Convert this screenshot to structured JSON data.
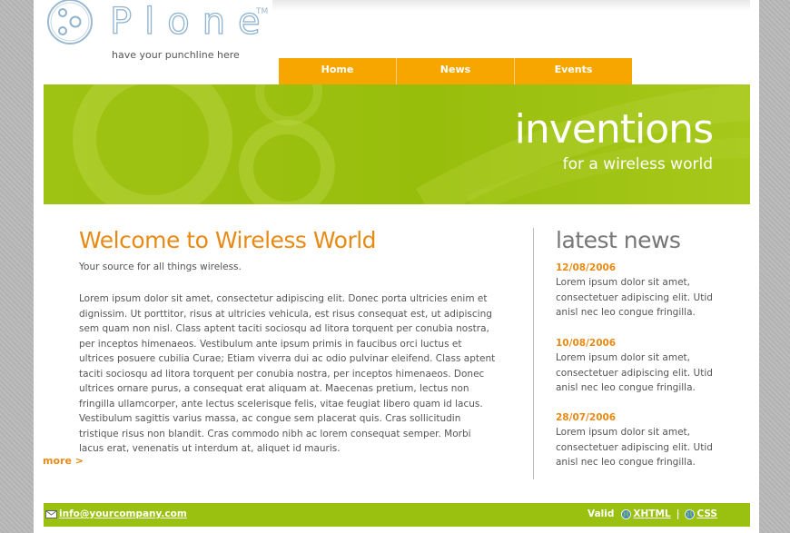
{
  "header": {
    "logo_text": "Plone",
    "logo_tm": "TM",
    "punchline": "have your punchline here"
  },
  "nav": [
    "Home",
    "News",
    "Events"
  ],
  "banner": {
    "title": "inventions",
    "subtitle": "for a wireless world"
  },
  "main": {
    "heading": "Welcome to Wireless World",
    "tagline": "Your source for all things wireless.",
    "body": "Lorem ipsum dolor sit amet, consectetur adipiscing elit. Donec porta ultricies enim et dignissim. Ut porttitor, risus at ultricies vehicula, est risus consequat est, ut adipiscing sem quam non nisl. Class aptent taciti sociosqu ad litora torquent per conubia nostra, per inceptos himenaeos. Vestibulum ante ipsum primis in faucibus orci luctus et ultrices posuere cubilia Curae; Etiam viverra dui ac odio pulvinar eleifend. Class aptent taciti sociosqu ad litora torquent per conubia nostra, per inceptos himenaeos. Donec ultrices ornare purus, a consequat erat aliquam at. Maecenas pretium, lectus non fringilla ullamcorper, ante lectus scelerisque felis, vitae feugiat libero quam id lacus. Vestibulum sagittis varius massa, ac congue sem placerat quis. Cras sollicitudin tristique risus non blandit. Cras commodo nibh ac lorem consequat semper. Morbi lacus erat, venenatis ut interdum at, aliquet id mauris.",
    "more": "more >"
  },
  "news": {
    "heading": "latest news",
    "items": [
      {
        "date": "12/08/2006",
        "text": "Lorem ipsum dolor sit amet, consectetuer adipiscing elit. Utid anisl nec leo congue fringilla."
      },
      {
        "date": "10/08/2006",
        "text": "Lorem ipsum dolor sit amet, consectetuer adipiscing elit. Utid anisl nec leo congue fringilla."
      },
      {
        "date": "28/07/2006",
        "text": "Lorem ipsum dolor sit amet, consectetuer adipiscing elit. Utid anisl nec leo congue fringilla."
      }
    ]
  },
  "footer": {
    "email": "info@yourcompany.com",
    "valid_label": "Valid",
    "xhtml": "XHTML",
    "separator": "|",
    "css": "CSS"
  },
  "colors": {
    "accent_orange": "#f7a600",
    "heading_orange": "#e88a14",
    "banner_green": "#9fc313",
    "footer_green": "#9ac10f"
  }
}
